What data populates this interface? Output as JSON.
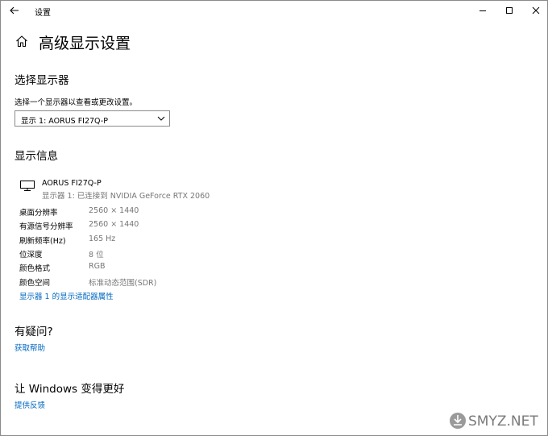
{
  "titlebar": {
    "app_title": "设置"
  },
  "page": {
    "title": "高级显示设置"
  },
  "select_display": {
    "heading": "选择显示器",
    "description": "选择一个显示器以查看或更改设置。",
    "dropdown_value": "显示 1: AORUS FI27Q-P"
  },
  "display_info": {
    "heading": "显示信息",
    "monitor_name": "AORUS FI27Q-P",
    "monitor_subtitle": "显示器 1: 已连接到 NVIDIA GeForce RTX 2060",
    "rows": [
      {
        "label": "桌面分辨率",
        "value": "2560 × 1440"
      },
      {
        "label": "有源信号分辨率",
        "value": "2560 × 1440"
      },
      {
        "label": "刷新频率(Hz)",
        "value": "165 Hz"
      },
      {
        "label": "位深度",
        "value": "8 位"
      },
      {
        "label": "颜色格式",
        "value": "RGB"
      },
      {
        "label": "颜色空间",
        "value": "标准动态范围(SDR)"
      }
    ],
    "adapter_link": "显示器 1 的显示适配器属性"
  },
  "help": {
    "heading": "有疑问?",
    "link": "获取帮助"
  },
  "feedback": {
    "heading": "让 Windows 变得更好",
    "link": "提供反馈"
  },
  "watermark": {
    "text": "SMYZ.NET"
  },
  "colors": {
    "link": "#0067c0",
    "secondary_text": "#767676"
  }
}
